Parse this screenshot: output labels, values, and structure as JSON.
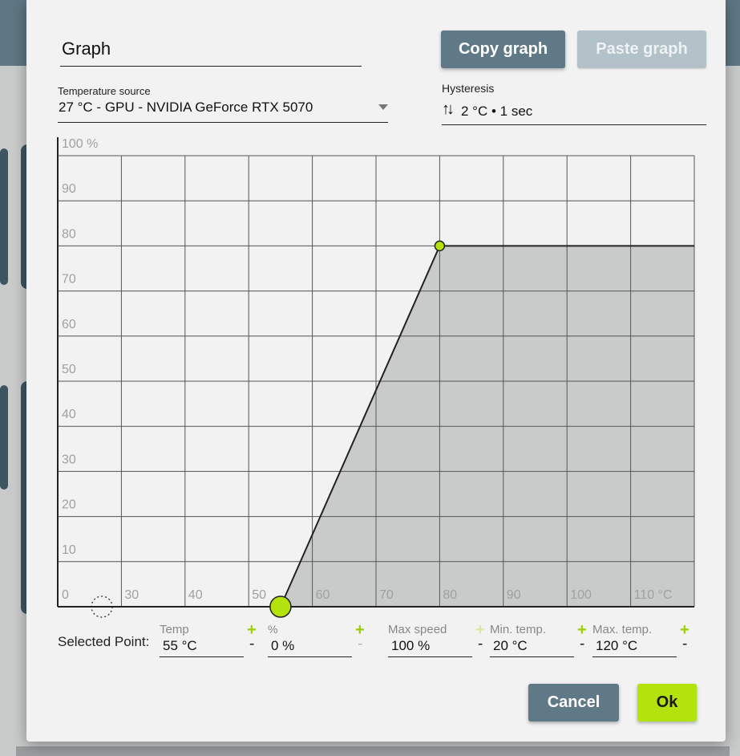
{
  "dialog": {
    "title": "Graph",
    "copy_label": "Copy graph",
    "paste_label": "Paste graph",
    "temp_source": {
      "label": "Temperature source",
      "value": "27 °C - GPU - NVIDIA GeForce RTX 5070"
    },
    "hysteresis": {
      "label": "Hysteresis",
      "icon": "up-down-arrows-icon",
      "value": "2 °C • 1 sec"
    }
  },
  "chart_data": {
    "type": "area",
    "x_ticks": [
      "",
      "30",
      "40",
      "50",
      "60",
      "70",
      "80",
      "90",
      "100",
      "110 °C"
    ],
    "y_ticks": [
      "0",
      "10",
      "20",
      "30",
      "40",
      "50",
      "60",
      "70",
      "80",
      "90",
      "100 %"
    ],
    "xlim": [
      20,
      120
    ],
    "ylim": [
      0,
      100
    ],
    "grid": true,
    "series": [
      {
        "points": [
          [
            20,
            0
          ],
          [
            55,
            0
          ],
          [
            80,
            80
          ],
          [
            120,
            80
          ]
        ]
      }
    ],
    "selected_point": [
      55,
      0
    ],
    "colors": {
      "fill": "#c9cbcb",
      "line": "#222222",
      "point": "#b3e20c"
    }
  },
  "selected_point": {
    "label": "Selected Point:",
    "temp": {
      "caption": "Temp",
      "value": "55 °C",
      "plus": "+",
      "minus": "-"
    },
    "percent": {
      "caption": "%",
      "value": "0 %",
      "plus": "+",
      "minus": "-"
    },
    "max_speed": {
      "caption": "Max speed",
      "value": "100 %",
      "plus": "+",
      "minus": "-"
    },
    "min_temp": {
      "caption": "Min. temp.",
      "value": "20 °C",
      "plus": "+",
      "minus": "-"
    },
    "max_temp": {
      "caption": "Max. temp.",
      "value": "120 °C",
      "plus": "+",
      "minus": "-"
    }
  },
  "footer": {
    "cancel_label": "Cancel",
    "ok_label": "Ok"
  },
  "colors": {
    "accent": "#b3e20c",
    "primary_button": "#5f7986",
    "disabled_button": "#b3c1c8",
    "app_header": "#5e7783"
  }
}
